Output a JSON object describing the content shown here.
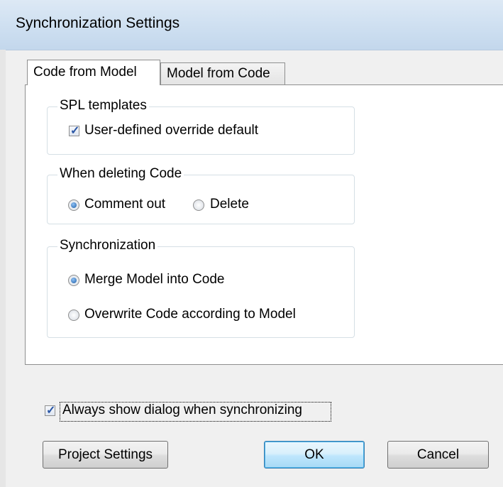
{
  "window": {
    "title": "Synchronization Settings"
  },
  "tabs": [
    {
      "label": "Code from Model",
      "active": true
    },
    {
      "label": "Model from Code",
      "active": false
    }
  ],
  "spl_templates": {
    "label": "SPL templates",
    "checkbox_label": "User-defined override default",
    "checked": true
  },
  "when_deleting": {
    "label": "When deleting Code",
    "options": [
      "Comment out",
      "Delete"
    ],
    "selected": "Comment out"
  },
  "synchronization": {
    "label": "Synchronization",
    "options": [
      "Merge Model into Code",
      "Overwrite Code according to Model"
    ],
    "selected": "Merge Model into Code"
  },
  "always_show": {
    "label": "Always show dialog when synchronizing",
    "checked": true
  },
  "buttons": {
    "project_settings": "Project Settings",
    "ok": "OK",
    "cancel": "Cancel"
  },
  "colors": {
    "accent": "#1e5fa8",
    "titlebar": "#cfe0f1"
  }
}
